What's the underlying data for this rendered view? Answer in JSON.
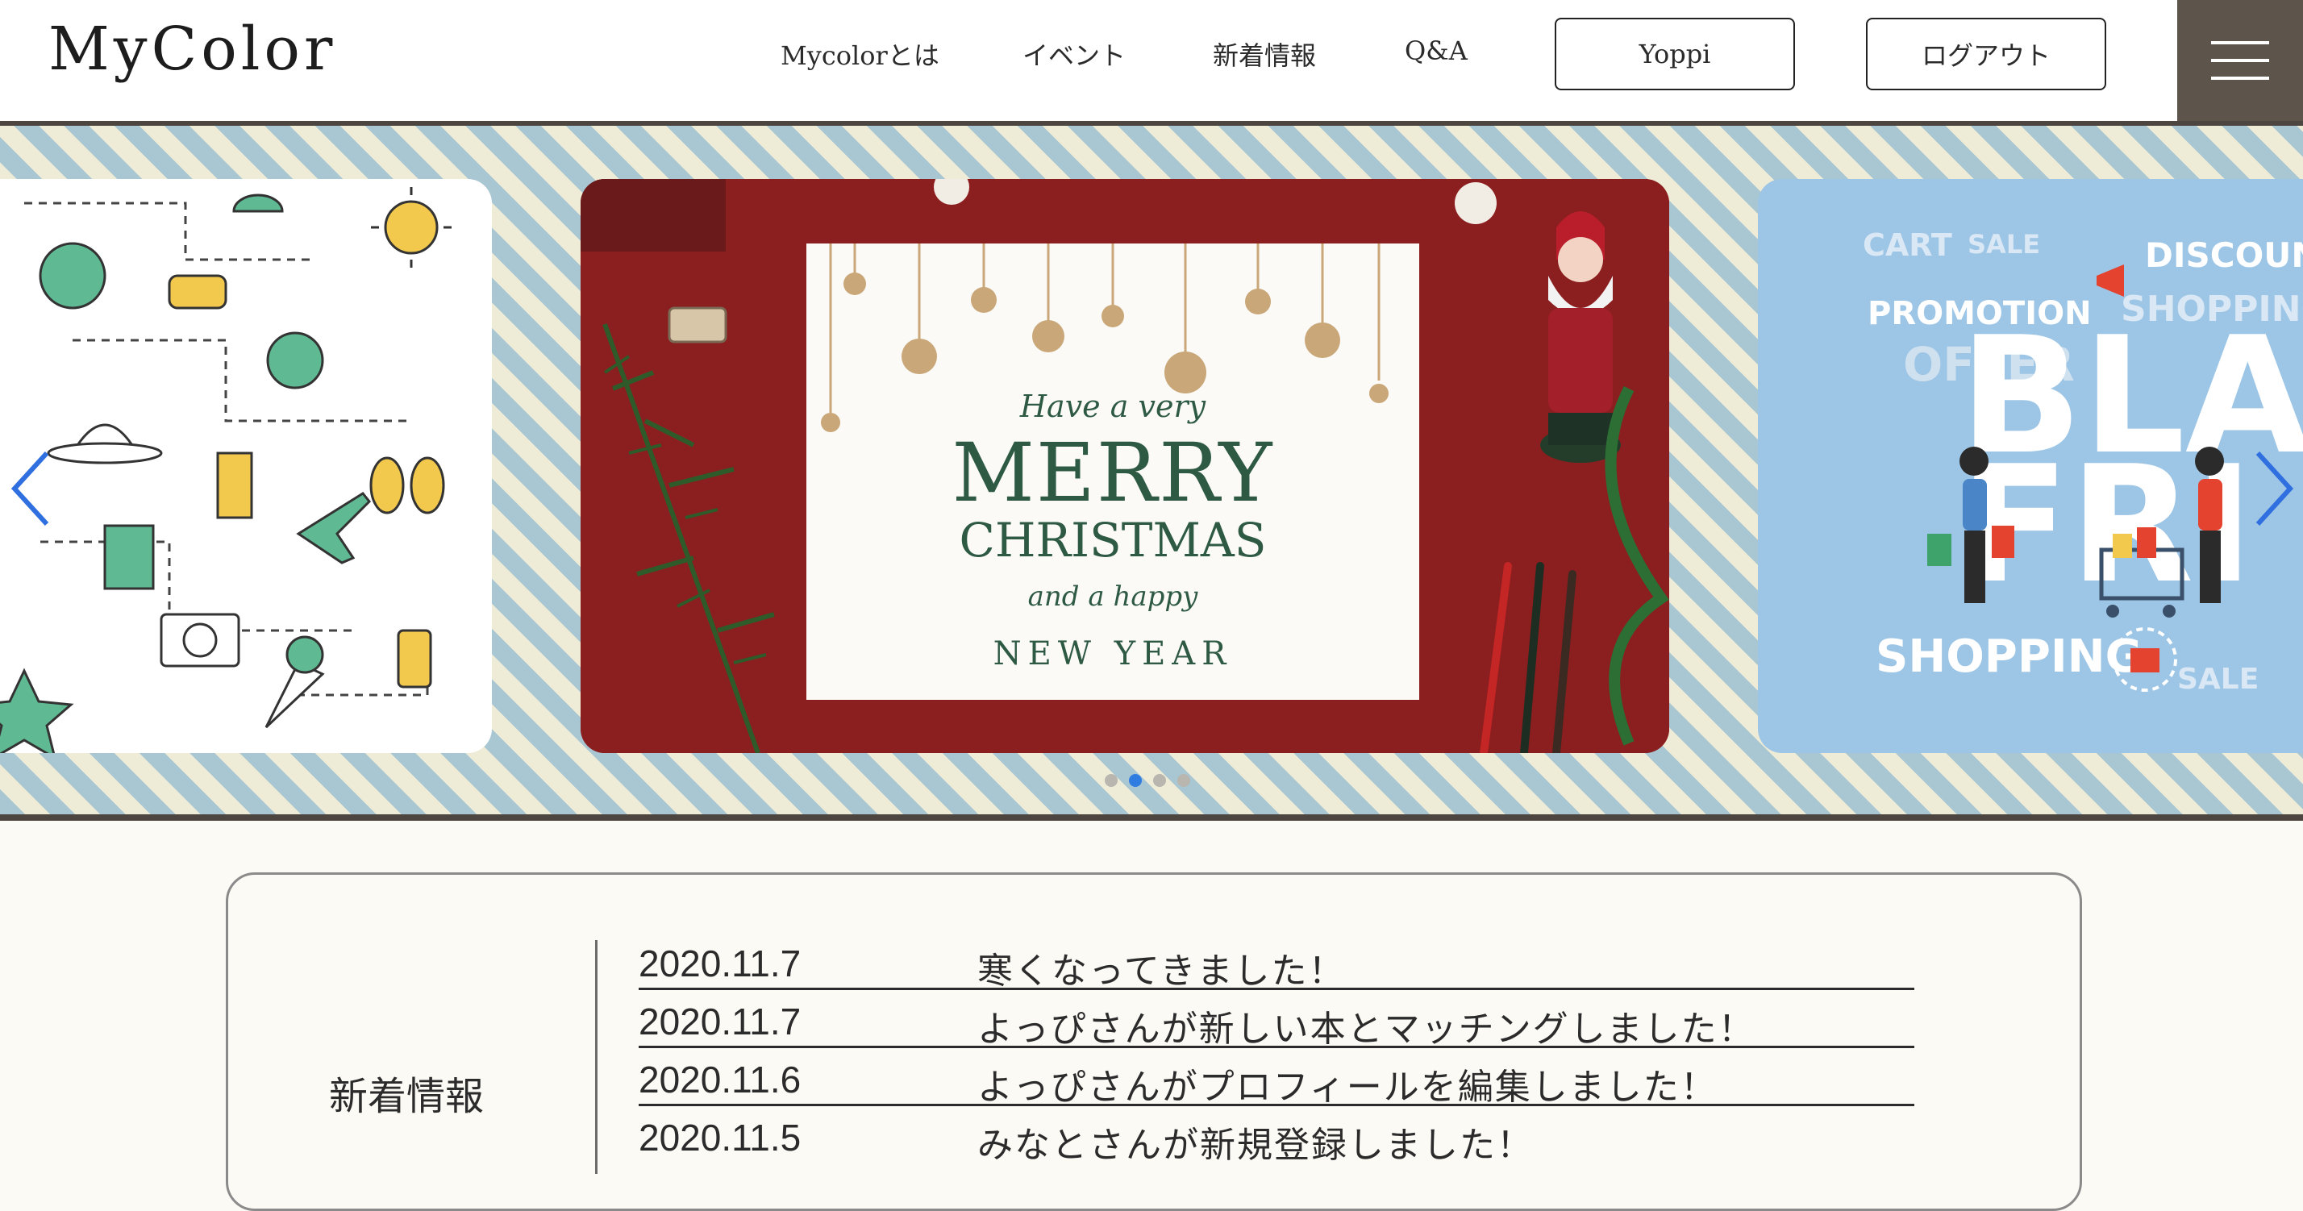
{
  "header": {
    "logo": "MyColor",
    "nav": [
      "Mycolorとは",
      "イベント",
      "新着情報",
      "Q&A"
    ],
    "user_button": "Yoppi",
    "logout_button": "ログアウト"
  },
  "carousel": {
    "slides": [
      {
        "name": "summer-travel-icons"
      },
      {
        "name": "christmas-card",
        "line1": "Have a very",
        "line2": "MERRY",
        "line3": "CHRISTMAS",
        "line4": "and a happy",
        "line5": "NEW YEAR"
      },
      {
        "name": "black-friday",
        "words": [
          "CART",
          "SALE",
          "DISCOUNT",
          "PROMOTION",
          "SHOPPING",
          "OFFER",
          "BLAC",
          "FRI",
          "SHOPPING",
          "SALE"
        ]
      }
    ],
    "active_dot": 1,
    "dot_count": 4
  },
  "news": {
    "title": "新着情報",
    "items": [
      {
        "date": "2020.11.7",
        "text": "寒くなってきました！"
      },
      {
        "date": "2020.11.7",
        "text": "よっぴさんが新しい本とマッチングしました！"
      },
      {
        "date": "2020.11.6",
        "text": "よっぴさんがプロフィールを編集しました！"
      },
      {
        "date": "2020.11.5",
        "text": "みなとさんが新規登録しました！"
      }
    ]
  },
  "colors": {
    "header_border": "#4d4640",
    "hamburger_bg": "#5d544b",
    "stripe_blue": "#a9c7d3",
    "stripe_cream": "#eeebd6",
    "dot_active": "#2f7de1",
    "page_bg": "#fbfaf5"
  }
}
